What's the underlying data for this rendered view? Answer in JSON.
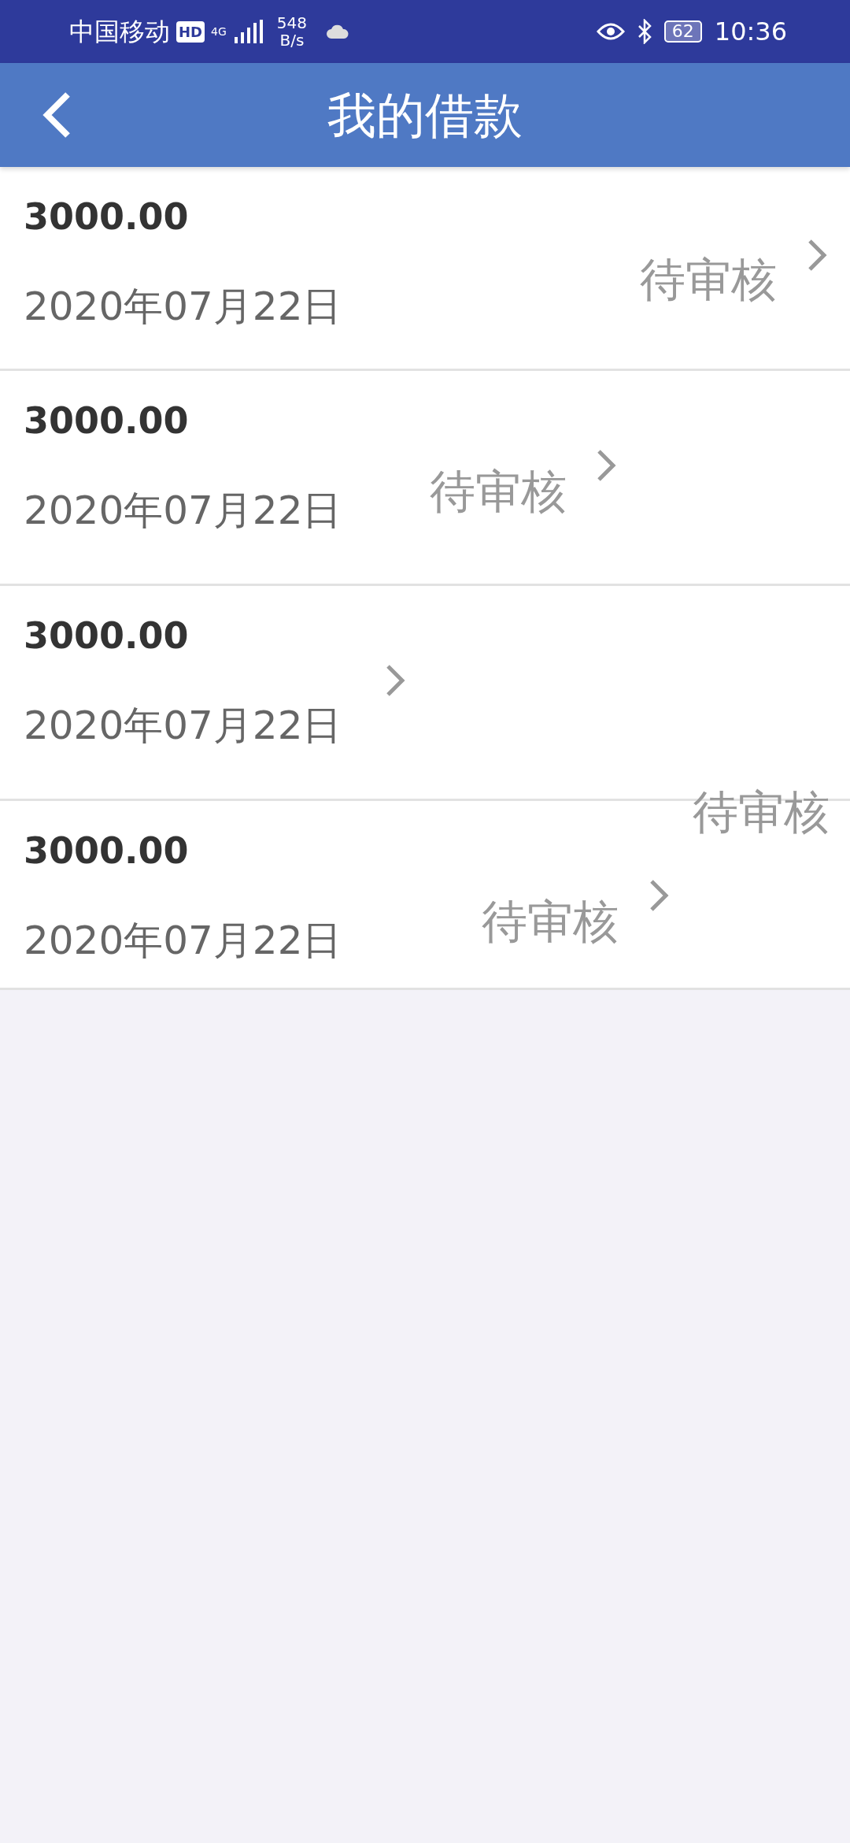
{
  "status_bar": {
    "carrier": "中国移动",
    "hd": "HD",
    "network": "4G",
    "speed_value": "548",
    "speed_unit": "B/s",
    "battery": "62",
    "time": "10:36"
  },
  "nav": {
    "title": "我的借款"
  },
  "loans": [
    {
      "amount": "3000.00",
      "date": "2020年07月22日",
      "status": "待审核"
    },
    {
      "amount": "3000.00",
      "date": "2020年07月22日",
      "status": "待审核"
    },
    {
      "amount": "3000.00",
      "date": "2020年07月22日",
      "status": "待审核"
    },
    {
      "amount": "3000.00",
      "date": "2020年07月22日",
      "status": "待审核"
    }
  ]
}
